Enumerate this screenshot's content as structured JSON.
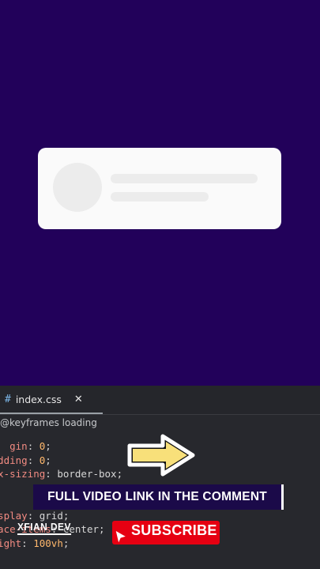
{
  "editor": {
    "tab": {
      "icon": "#",
      "filename": "index.css",
      "close_icon": "✕"
    },
    "breadcrumb": "@keyframes loading",
    "code_lines": [
      [
        {
          "c": "p",
          "t": "    gin"
        },
        {
          "c": "t",
          "t": ": "
        },
        {
          "c": "v",
          "t": "0"
        },
        {
          "c": "t",
          "t": ";"
        }
      ],
      [
        {
          "c": "p",
          "t": "  dding"
        },
        {
          "c": "t",
          "t": ": "
        },
        {
          "c": "v",
          "t": "0"
        },
        {
          "c": "t",
          "t": ";"
        }
      ],
      [
        {
          "c": "p",
          "t": "  x-sizing"
        },
        {
          "c": "t",
          "t": ": border-box;"
        }
      ],
      [
        {
          "c": "t",
          "t": ""
        }
      ],
      [
        {
          "c": "t",
          "t": ""
        }
      ],
      [
        {
          "c": "p",
          "t": "  splay"
        },
        {
          "c": "t",
          "t": ": grid;"
        }
      ],
      [
        {
          "c": "p",
          "t": "  ace-items"
        },
        {
          "c": "t",
          "t": ": center;"
        }
      ],
      [
        {
          "c": "p",
          "t": "  ight"
        },
        {
          "c": "t",
          "t": ": "
        },
        {
          "c": "v",
          "t": "100vh"
        },
        {
          "c": "t",
          "t": ";"
        }
      ]
    ]
  },
  "overlay": {
    "banner_text": "FULL VIDEO LINK IN THE COMMENT",
    "brand": "XFIAN DEV",
    "subscribe_label": "SUBSCRIBE",
    "arrow_icon": "arrow-right-icon"
  },
  "colors": {
    "background": "#22015a",
    "card": "#fafafa",
    "skeleton": "#ececec",
    "subscribe": "#e60012",
    "arrow_fill": "#f8e07a"
  }
}
